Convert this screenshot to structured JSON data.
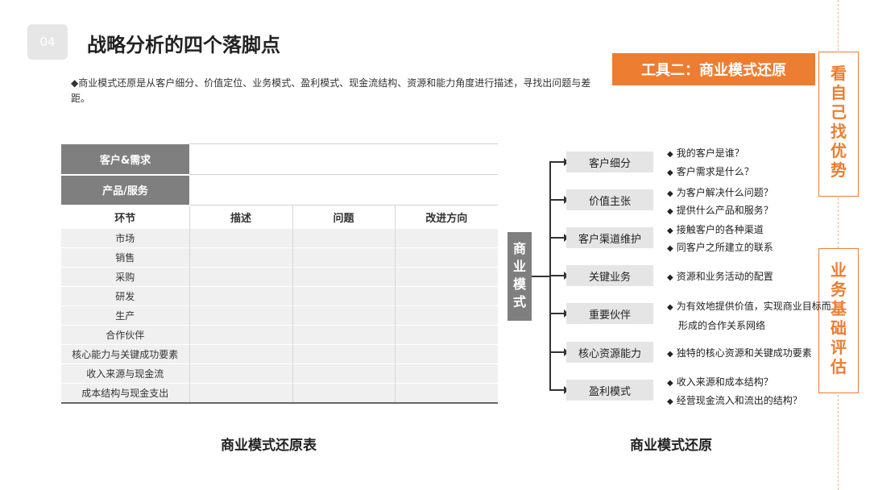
{
  "header": {
    "number": "04",
    "title": "战略分析的四个落脚点"
  },
  "intro": "◆商业模式还原是从客户细分、价值定位、业务模式、盈利模式、现金流结构、资源和能力角度进行描述，寻找出问题与差距。",
  "tool_banner": "工具二：商业模式还原",
  "side_labels": [
    [
      "看",
      "自",
      "己",
      "找",
      "优",
      "势"
    ],
    [
      "业",
      "务",
      "基",
      "础",
      "评",
      "估"
    ]
  ],
  "table": {
    "top_rows": [
      "客户&需求",
      "产品/服务"
    ],
    "columns": [
      "环节",
      "描述",
      "问题",
      "改进方向"
    ],
    "rows": [
      "市场",
      "销售",
      "采购",
      "研发",
      "生产",
      "合作伙伴",
      "核心能力与关键成功要素",
      "收入来源与现金流",
      "成本结构与现金支出"
    ],
    "caption": "商业模式还原表"
  },
  "diagram": {
    "center": [
      "商",
      "业",
      "模",
      "式"
    ],
    "nodes": [
      {
        "label": "客户细分",
        "questions": [
          "我的客户是谁？",
          "客户需求是什么？"
        ]
      },
      {
        "label": "价值主张",
        "questions": [
          "为客户解决什么问题？",
          "提供什么产品和服务？"
        ]
      },
      {
        "label": "客户渠道维护",
        "questions": [
          "接触客户的各种渠道",
          "同客户之所建立的联系"
        ]
      },
      {
        "label": "关键业务",
        "questions": [
          "资源和业务活动的配置"
        ]
      },
      {
        "label": "重要伙伴",
        "questions": [
          "为有效地提供价值，实现商业目标而形成的合作关系网络"
        ]
      },
      {
        "label": "核心资源能力",
        "questions": [
          "独特的核心资源和关键成功要素"
        ]
      },
      {
        "label": "盈利模式",
        "questions": [
          "收入来源和成本结构？",
          "经营现金流入和流出的结构？"
        ]
      }
    ],
    "bullet": "◆",
    "caption": "商业模式还原"
  }
}
